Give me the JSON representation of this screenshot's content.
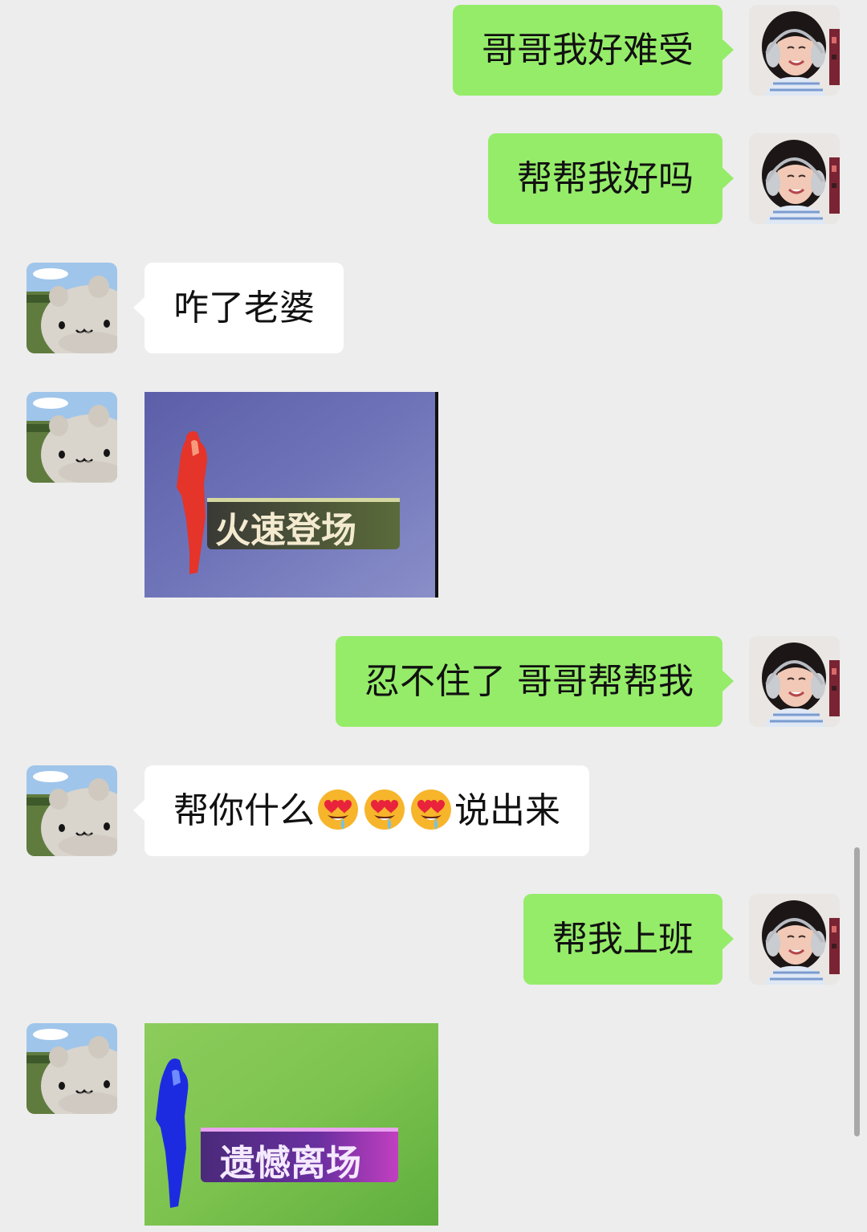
{
  "messages": [
    {
      "side": "out",
      "text": "哥哥我好难受"
    },
    {
      "side": "out",
      "text": "帮帮我好吗"
    },
    {
      "side": "in",
      "text": "咋了老婆"
    },
    {
      "side": "in",
      "type": "sticker",
      "caption": "火速登场"
    },
    {
      "side": "out",
      "text": "忍不住了 哥哥帮帮我"
    },
    {
      "side": "in",
      "text_before": "帮你什么",
      "emojis": [
        "heart-eyes-drool-emoji",
        "heart-eyes-drool-emoji",
        "heart-eyes-drool-emoji"
      ],
      "text_after": "说出来"
    },
    {
      "side": "out",
      "text": "帮我上班"
    },
    {
      "side": "in",
      "type": "sticker",
      "caption": "遗憾离场"
    }
  ],
  "avatars": {
    "me": "girl-with-headphones-avatar",
    "contact": "cartoon-cat-avatar"
  },
  "colors": {
    "background": "#ededed",
    "outgoing_bubble": "#95ec69",
    "incoming_bubble": "#ffffff",
    "text": "#111111"
  }
}
